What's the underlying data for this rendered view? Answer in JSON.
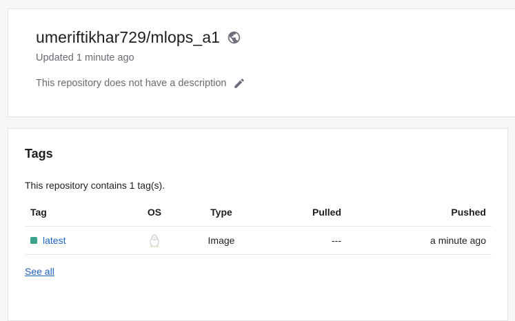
{
  "repo": {
    "name": "umeriftikhar729/mlops_a1",
    "visibility_icon": "globe-icon",
    "updated": "Updated 1 minute ago",
    "description": "This repository does not have a description",
    "edit_icon": "pencil-icon"
  },
  "tags": {
    "heading": "Tags",
    "count_text": "This repository contains 1 tag(s).",
    "columns": [
      "Tag",
      "OS",
      "Type",
      "Pulled",
      "Pushed"
    ],
    "rows": [
      {
        "tag": "latest",
        "status_color": "#3aa38a",
        "os_icon": "linux-icon",
        "type": "Image",
        "pulled": "---",
        "pushed": "a minute ago"
      }
    ],
    "see_all": "See all"
  }
}
